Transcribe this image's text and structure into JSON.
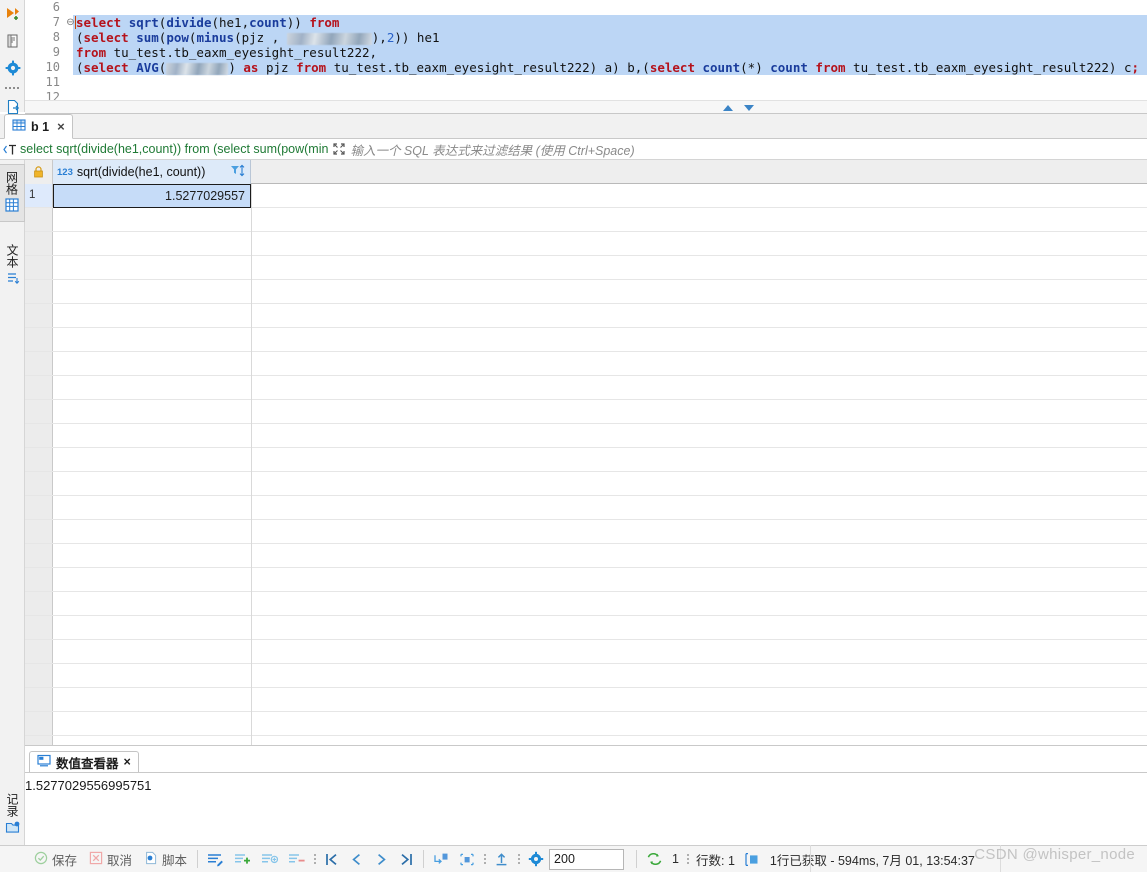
{
  "editor": {
    "lines": [
      {
        "number": "6",
        "fold": "",
        "selected": false,
        "tokens": []
      },
      {
        "number": "7",
        "fold": "⊖",
        "selected": true,
        "tokens": [
          {
            "t": "caret",
            "v": ""
          },
          {
            "t": "kw",
            "v": "select"
          },
          {
            "t": "pl",
            "v": " "
          },
          {
            "t": "fn",
            "v": "sqrt"
          },
          {
            "t": "pl",
            "v": "("
          },
          {
            "t": "fn",
            "v": "divide"
          },
          {
            "t": "pl",
            "v": "(he1,"
          },
          {
            "t": "fn",
            "v": "count"
          },
          {
            "t": "pl",
            "v": ")) "
          },
          {
            "t": "kw",
            "v": "from"
          }
        ]
      },
      {
        "number": "8",
        "fold": "",
        "selected": true,
        "tokens": [
          {
            "t": "pl",
            "v": "("
          },
          {
            "t": "kw",
            "v": "select"
          },
          {
            "t": "pl",
            "v": " "
          },
          {
            "t": "fn",
            "v": "sum"
          },
          {
            "t": "pl",
            "v": "("
          },
          {
            "t": "fn",
            "v": "pow"
          },
          {
            "t": "pl",
            "v": "("
          },
          {
            "t": "fn",
            "v": "minus"
          },
          {
            "t": "pl",
            "v": "(pjz , "
          },
          {
            "t": "redact",
            "v": "",
            "w": 85
          },
          {
            "t": "pl",
            "v": "),"
          },
          {
            "t": "num",
            "v": "2"
          },
          {
            "t": "pl",
            "v": ")) he1"
          }
        ]
      },
      {
        "number": "9",
        "fold": "",
        "selected": true,
        "tokens": [
          {
            "t": "kw",
            "v": "from"
          },
          {
            "t": "pl",
            "v": " tu_test.tb_eaxm_eyesight_result222,"
          }
        ]
      },
      {
        "number": "10",
        "fold": "",
        "selected": true,
        "tokens": [
          {
            "t": "pl",
            "v": "("
          },
          {
            "t": "kw",
            "v": "select"
          },
          {
            "t": "pl",
            "v": " "
          },
          {
            "t": "fn",
            "v": "AVG"
          },
          {
            "t": "pl",
            "v": "("
          },
          {
            "t": "redact",
            "v": "",
            "w": 62
          },
          {
            "t": "pl",
            "v": ") "
          },
          {
            "t": "kw",
            "v": "as"
          },
          {
            "t": "pl",
            "v": " pjz "
          },
          {
            "t": "kw",
            "v": "from"
          },
          {
            "t": "pl",
            "v": " tu_test.tb_eaxm_eyesight_result222) a) b,("
          },
          {
            "t": "kw",
            "v": "select"
          },
          {
            "t": "pl",
            "v": " "
          },
          {
            "t": "fn",
            "v": "count"
          },
          {
            "t": "pl",
            "v": "(*) "
          },
          {
            "t": "fn",
            "v": "count"
          },
          {
            "t": "pl",
            "v": " "
          },
          {
            "t": "kw",
            "v": "from"
          },
          {
            "t": "pl",
            "v": " tu_test.tb_eaxm_eyesight_result222) c"
          },
          {
            "t": "kw",
            "v": ";"
          }
        ]
      },
      {
        "number": "11",
        "fold": "",
        "selected": false,
        "tokens": []
      },
      {
        "number": "12",
        "fold": "",
        "selected": false,
        "tokens": []
      }
    ]
  },
  "left_rail": {
    "icons": [
      "run-script-icon",
      "script-icon",
      "settings-gear-icon",
      "more-dots-icon",
      "export-file-icon",
      "new-file-icon"
    ]
  },
  "result_tab": {
    "label": "b 1",
    "icon": "grid-table-icon",
    "close": "×"
  },
  "filter_bar": {
    "icon": "sql-filter-icon",
    "sql_text": "select sqrt(divide(he1,count)) from (select sum(pow(min",
    "expand_icon": "expand-icon",
    "placeholder": "输入一个 SQL 表达式来过滤结果 (使用 Ctrl+Space)"
  },
  "view_tabs": [
    {
      "label": "网格",
      "icon": "grid-view-icon",
      "active": true
    },
    {
      "label": "文本",
      "icon": "text-view-icon",
      "active": false
    }
  ],
  "grid": {
    "lock_icon": "lock-icon",
    "column": {
      "type_badge": "123",
      "name": "sqrt(divide(he1, count))",
      "sort_filter_icon": "filter-sort-icon"
    },
    "rows": [
      {
        "num": "1",
        "value": "1.5277029557"
      }
    ],
    "empty_row_count": 23
  },
  "value_viewer": {
    "tab_label": "数值查看器",
    "tab_icon": "value-viewer-icon",
    "close": "×",
    "value": "1.5277029556995751",
    "rail_label": "记录",
    "rail_icon": "record-icon"
  },
  "status_bar": {
    "save_label": "保存",
    "save_icon": "check-circle-icon",
    "cancel_label": "取消",
    "cancel_icon": "cancel-box-icon",
    "script_label": "脚本",
    "script_icon": "script-doc-icon",
    "edit_row_icon": "edit-row-icon",
    "add_row_icon": "add-row-icon",
    "duplicate_row_icon": "duplicate-row-icon",
    "delete_row_icon": "delete-row-icon",
    "first_page_icon": "first-page-icon",
    "prev_page_icon": "prev-page-icon",
    "next_page_icon": "next-page-icon",
    "last_page_icon": "last-page-icon",
    "fetch_next_icon": "fetch-next-page-icon",
    "fetch_all_icon": "fetch-all-rows-icon",
    "export_icon": "export-icon",
    "config_icon": "gear-icon",
    "fetch_size": "200",
    "refresh_icon": "refresh-icon",
    "refresh_count": "1",
    "rows_label": "行数: 1",
    "calc_icon": "column-stat-icon",
    "fetch_status": "1行已获取 - 594ms, 7月 01, 13:54:37"
  },
  "watermark": "CSDN @whisper_node",
  "colors": {
    "selection_blue": "#bcd6f5",
    "keyword_red": "#b5121b",
    "function_blue": "#1a3c9c",
    "filter_green": "#1f7a35",
    "header_blue": "#ddeaf9",
    "cell_blue": "#c6dcf8",
    "accent_blue": "#2a7fd4"
  }
}
